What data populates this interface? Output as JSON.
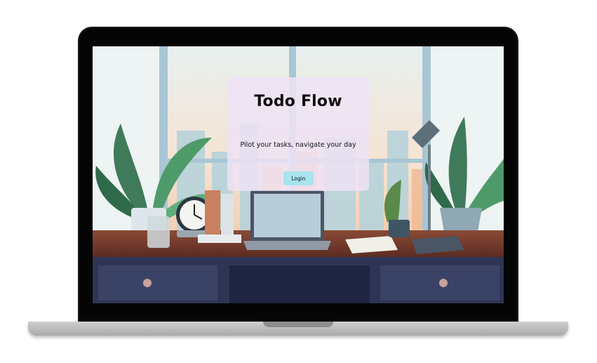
{
  "app": {
    "title": "Todo Flow",
    "tagline": "Pilot your tasks, navigate your day"
  },
  "actions": {
    "login_label": "Login"
  },
  "colors": {
    "card_background": "#eee2f6",
    "login_button": "#a8e4ee",
    "laptop_bezel": "#050505",
    "laptop_base": "#bdbdbd"
  },
  "icons": {
    "clock": "alarm-clock-icon",
    "lamp": "desk-lamp-icon"
  }
}
